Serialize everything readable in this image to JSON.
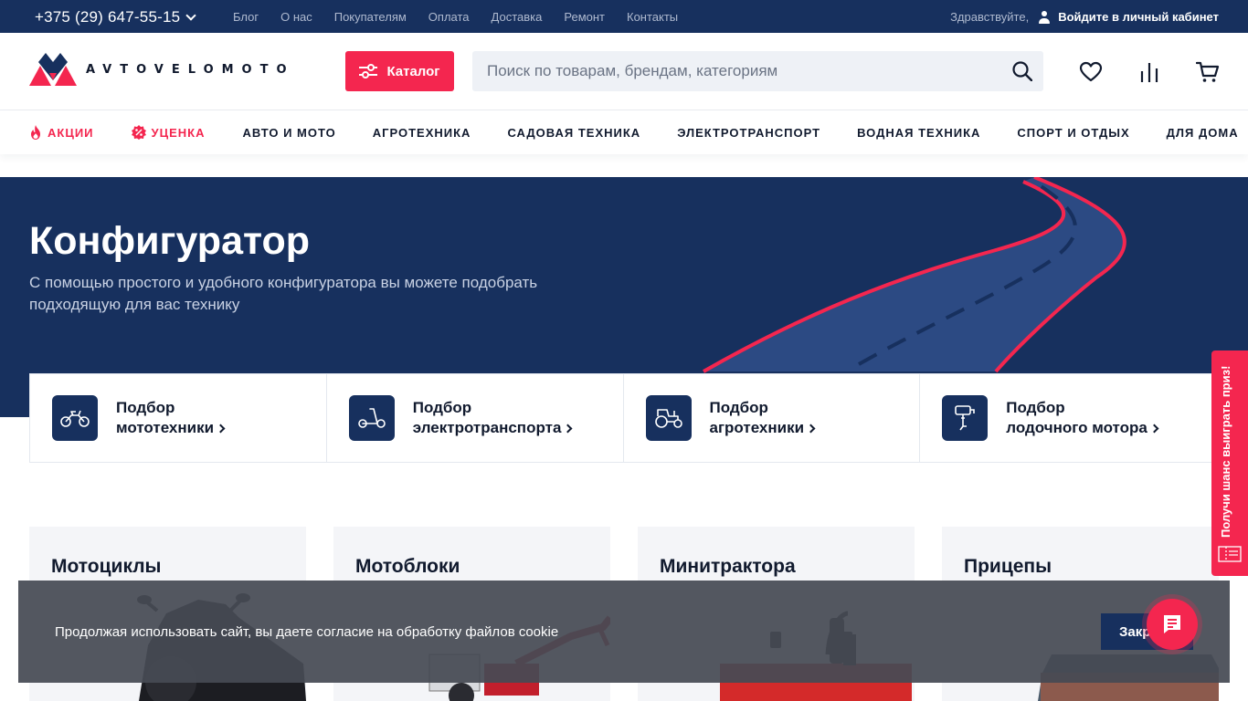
{
  "topbar": {
    "phone": "+375 (29) 647-55-15",
    "links": [
      "Блог",
      "О нас",
      "Покупателям",
      "Оплата",
      "Доставка",
      "Ремонт",
      "Контакты"
    ],
    "greeting": "Здравствуйте,",
    "login": "Войдите в личный кабинет"
  },
  "header": {
    "logo_text": "AVTOVELOMOTO",
    "catalog_label": "Каталог",
    "search_placeholder": "Поиск по товарам, брендам, категориям"
  },
  "menu": {
    "items": [
      "АКЦИИ",
      "УЦЕНКА",
      "АВТО И МОТО",
      "АГРОТЕХНИКА",
      "САДОВАЯ ТЕХНИКА",
      "ЭЛЕКТРОТРАНСПОРТ",
      "ВОДНАЯ ТЕХНИКА",
      "СПОРТ И ОТДЫХ",
      "ДЛЯ ДОМА"
    ]
  },
  "hero": {
    "title": "Конфигуратор",
    "subtitle": "С помощью простого и удобного конфигуратора вы можете подобрать подходящую для вас технику"
  },
  "configurators": [
    {
      "line1": "Подбор",
      "line2": "мототехники",
      "icon": "motorcycle-icon"
    },
    {
      "line1": "Подбор",
      "line2": "электротранспорта",
      "icon": "scooter-icon"
    },
    {
      "line1": "Подбор",
      "line2": "агротехники",
      "icon": "tractor-icon"
    },
    {
      "line1": "Подбор",
      "line2": "лодочного мотора",
      "icon": "boat-motor-icon"
    }
  ],
  "categories": [
    "Мотоциклы",
    "Мотоблоки",
    "Минитрактора",
    "Прицепы"
  ],
  "prize_tab": "Получи шанс выиграть приз!",
  "cookie": {
    "text": "Продолжая использовать сайт, вы даете согласие на обработку файлов cookie",
    "button": "Закрыть"
  },
  "colors": {
    "navy": "#17305e",
    "accent": "#f4264f"
  }
}
